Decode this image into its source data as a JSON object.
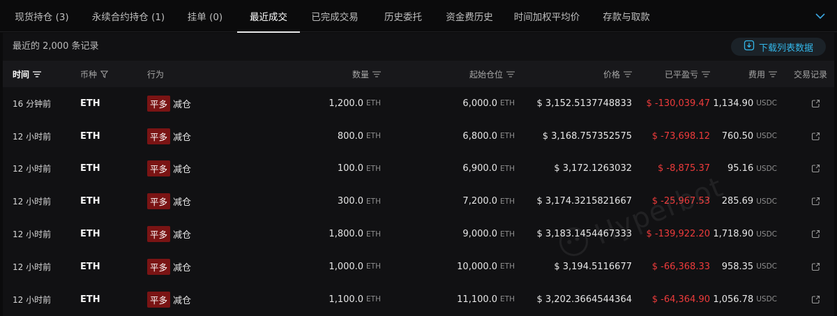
{
  "tabs": [
    {
      "label": "现货持仓 (3)",
      "active": false
    },
    {
      "label": "永续合约持仓 (1)",
      "active": false
    },
    {
      "label": "挂单 (0)",
      "active": false
    },
    {
      "label": "最近成交",
      "active": true
    },
    {
      "label": "已完成交易",
      "active": false
    },
    {
      "label": "历史委托",
      "active": false
    },
    {
      "label": "资金费历史",
      "active": false
    },
    {
      "label": "时间加权平均价",
      "active": false
    },
    {
      "label": "存款与取款",
      "active": false
    }
  ],
  "toolbar": {
    "records_info": "最近的 2,000 条记录",
    "download_label": "下载列表数据"
  },
  "columns": {
    "time": "时间",
    "coin": "币种",
    "action": "行为",
    "qty": "数量",
    "start_position": "起始仓位",
    "price": "价格",
    "closed_pnl": "已平盈亏",
    "fee": "费用",
    "trade_record": "交易记录"
  },
  "rows": [
    {
      "time": "16 分钟前",
      "coin": "ETH",
      "badge": "平多",
      "action": "减仓",
      "qty": "1,200.0",
      "qty_unit": "ETH",
      "start": "6,000.0",
      "start_unit": "ETH",
      "price": "$ 3,152.5137748833",
      "pnl": "$ -130,039.47",
      "fee": "1,134.90",
      "fee_unit": "USDC"
    },
    {
      "time": "12 小时前",
      "coin": "ETH",
      "badge": "平多",
      "action": "减仓",
      "qty": "800.0",
      "qty_unit": "ETH",
      "start": "6,800.0",
      "start_unit": "ETH",
      "price": "$ 3,168.757352575",
      "pnl": "$ -73,698.12",
      "fee": "760.50",
      "fee_unit": "USDC"
    },
    {
      "time": "12 小时前",
      "coin": "ETH",
      "badge": "平多",
      "action": "减仓",
      "qty": "100.0",
      "qty_unit": "ETH",
      "start": "6,900.0",
      "start_unit": "ETH",
      "price": "$ 3,172.1263032",
      "pnl": "$ -8,875.37",
      "fee": "95.16",
      "fee_unit": "USDC"
    },
    {
      "time": "12 小时前",
      "coin": "ETH",
      "badge": "平多",
      "action": "减仓",
      "qty": "300.0",
      "qty_unit": "ETH",
      "start": "7,200.0",
      "start_unit": "ETH",
      "price": "$ 3,174.3215821667",
      "pnl": "$ -25,967.53",
      "fee": "285.69",
      "fee_unit": "USDC"
    },
    {
      "time": "12 小时前",
      "coin": "ETH",
      "badge": "平多",
      "action": "减仓",
      "qty": "1,800.0",
      "qty_unit": "ETH",
      "start": "9,000.0",
      "start_unit": "ETH",
      "price": "$ 3,183.1454467333",
      "pnl": "$ -139,922.20",
      "fee": "1,718.90",
      "fee_unit": "USDC"
    },
    {
      "time": "12 小时前",
      "coin": "ETH",
      "badge": "平多",
      "action": "减仓",
      "qty": "1,000.0",
      "qty_unit": "ETH",
      "start": "10,000.0",
      "start_unit": "ETH",
      "price": "$ 3,194.5116677",
      "pnl": "$ -66,368.33",
      "fee": "958.35",
      "fee_unit": "USDC"
    },
    {
      "time": "12 小时前",
      "coin": "ETH",
      "badge": "平多",
      "action": "减仓",
      "qty": "1,100.0",
      "qty_unit": "ETH",
      "start": "11,100.0",
      "start_unit": "ETH",
      "price": "$ 3,202.3664544364",
      "pnl": "$ -64,364.90",
      "fee": "1,056.78",
      "fee_unit": "USDC"
    }
  ],
  "watermark": "Hyperbot",
  "icons": {
    "collapse": "chevron-down-icon",
    "download": "download-icon",
    "sort": "sort-icon",
    "filter": "filter-icon",
    "external_link": "external-link-icon",
    "watermark_logo": "hyperbot-logo-icon"
  },
  "colors": {
    "accent": "#33b6e8",
    "loss": "#ee3b3b",
    "badge_bg": "#7a1414",
    "background": "#0b0b0c",
    "panel": "#111113"
  }
}
